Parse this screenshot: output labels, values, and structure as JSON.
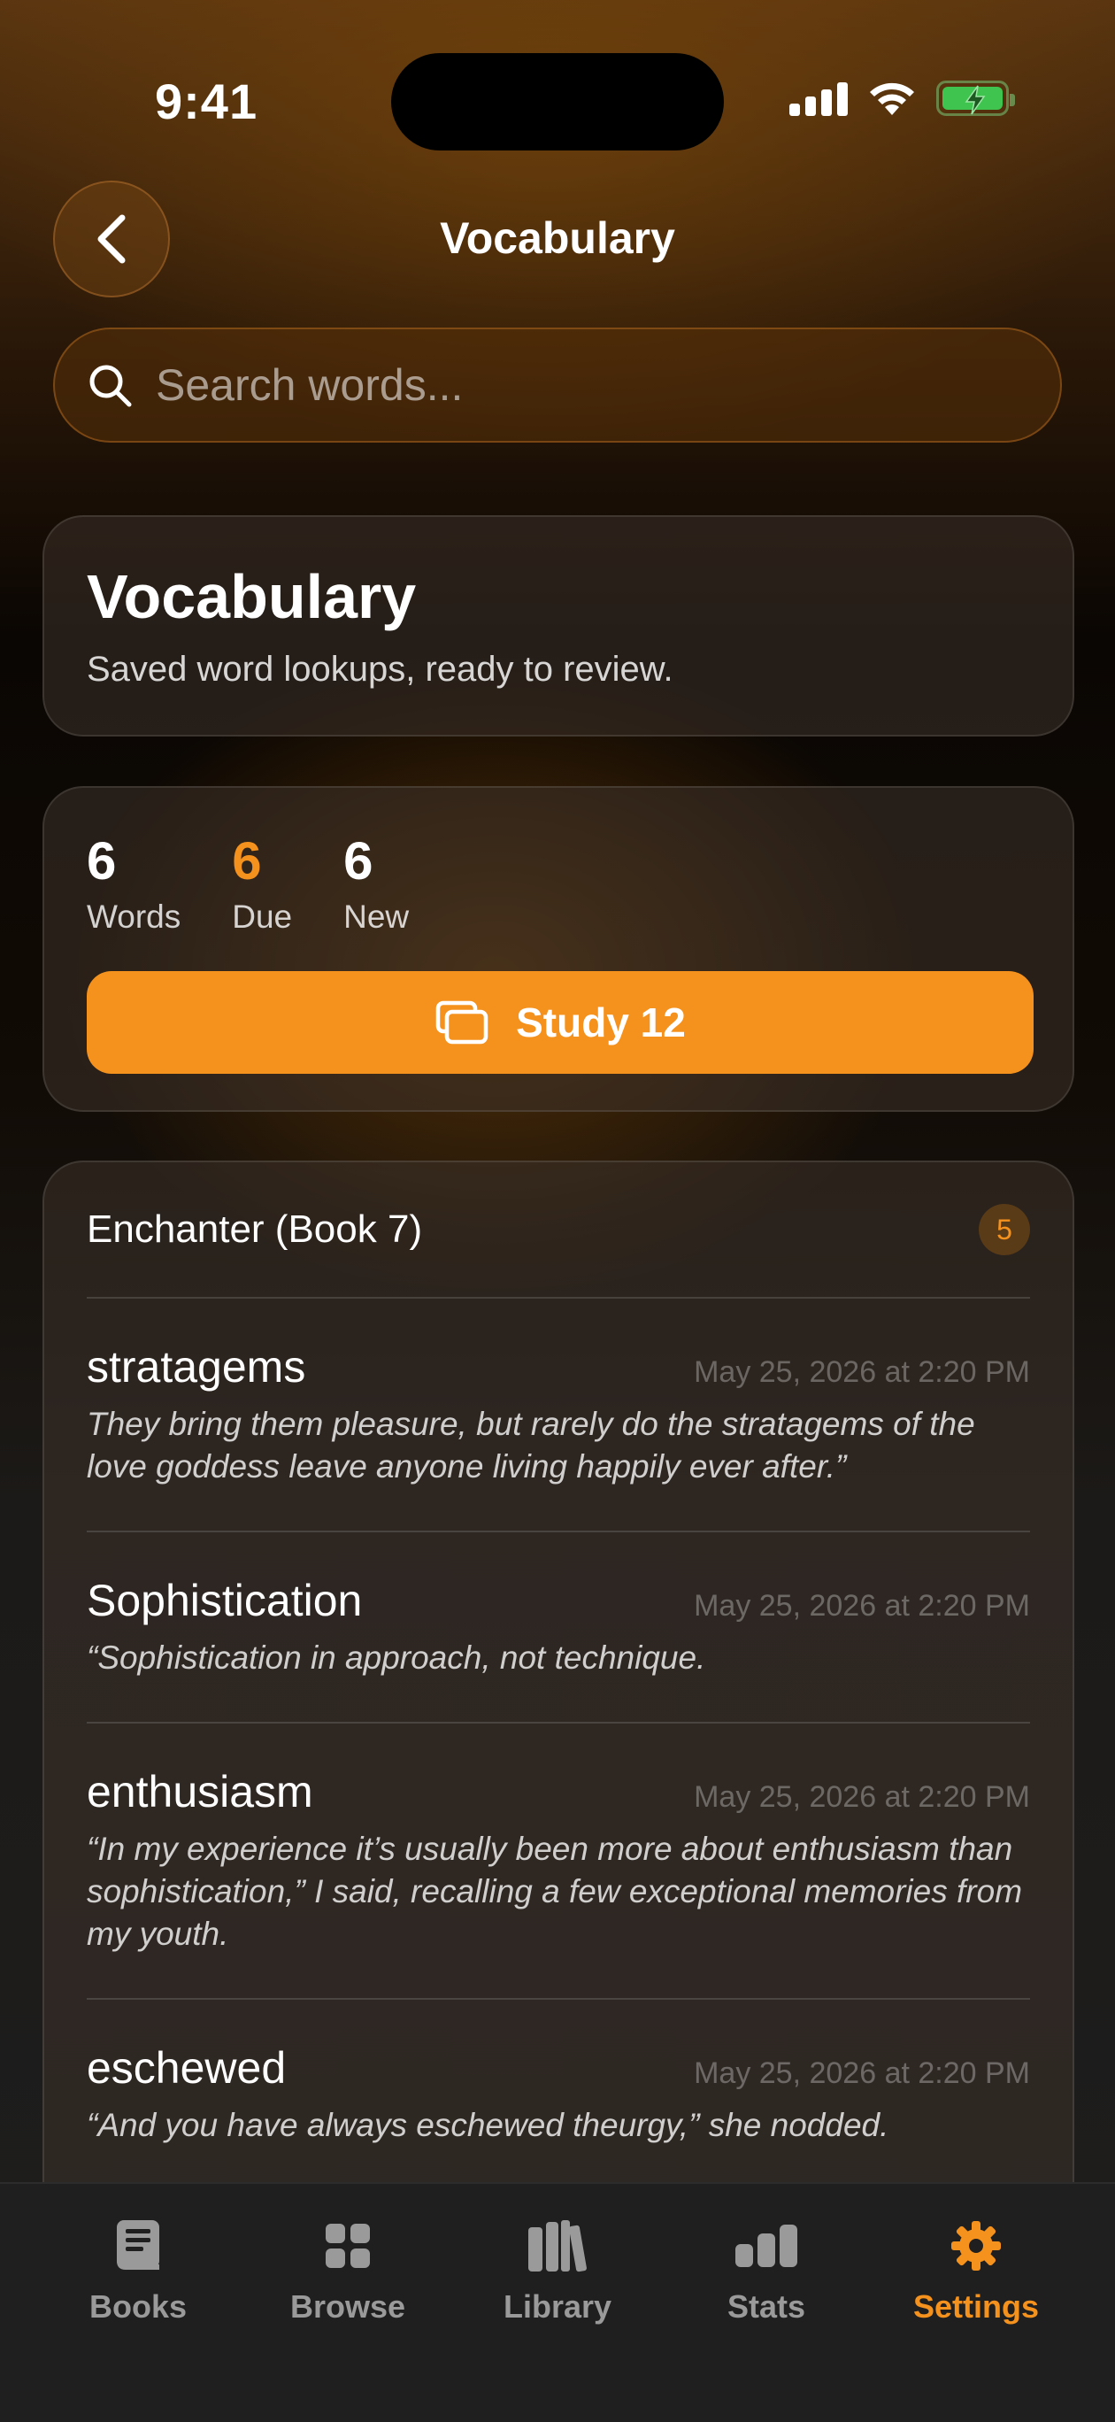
{
  "status_bar": {
    "time": "9:41"
  },
  "nav": {
    "title": "Vocabulary"
  },
  "search": {
    "placeholder": "Search words..."
  },
  "header_card": {
    "title": "Vocabulary",
    "subtitle": "Saved word lookups, ready to review."
  },
  "stats": [
    {
      "value": "6",
      "label": "Words"
    },
    {
      "value": "6",
      "label": "Due"
    },
    {
      "value": "6",
      "label": "New"
    }
  ],
  "study_button": {
    "label": "Study 12"
  },
  "book_group": {
    "title": "Enchanter (Book 7)",
    "count": "5",
    "entries": [
      {
        "word": "stratagems",
        "date": "May 25, 2026 at 2:20 PM",
        "context": "They bring them pleasure, but rarely do the stratagems of the love goddess leave anyone living happily ever after.”"
      },
      {
        "word": "Sophistication",
        "date": "May 25, 2026 at 2:20 PM",
        "context": "“Sophistication in approach, not technique."
      },
      {
        "word": "enthusiasm",
        "date": "May 25, 2026 at 2:20 PM",
        "context": "“In my experience it’s usually been more about enthusiasm than sophistication,” I said, recalling a few exceptional memories from my youth."
      },
      {
        "word": "eschewed",
        "date": "May 25, 2026 at 2:20 PM",
        "context": "“And you have always eschewed theurgy,” she nodded."
      }
    ]
  },
  "tabs": [
    {
      "label": "Books",
      "icon": "book-icon"
    },
    {
      "label": "Browse",
      "icon": "grid-icon"
    },
    {
      "label": "Library",
      "icon": "library-icon"
    },
    {
      "label": "Stats",
      "icon": "bar-chart-icon"
    },
    {
      "label": "Settings",
      "icon": "gear-icon",
      "active": true
    }
  ],
  "colors": {
    "accent": "#f5921e",
    "tab_inactive": "#9a9a9a"
  }
}
